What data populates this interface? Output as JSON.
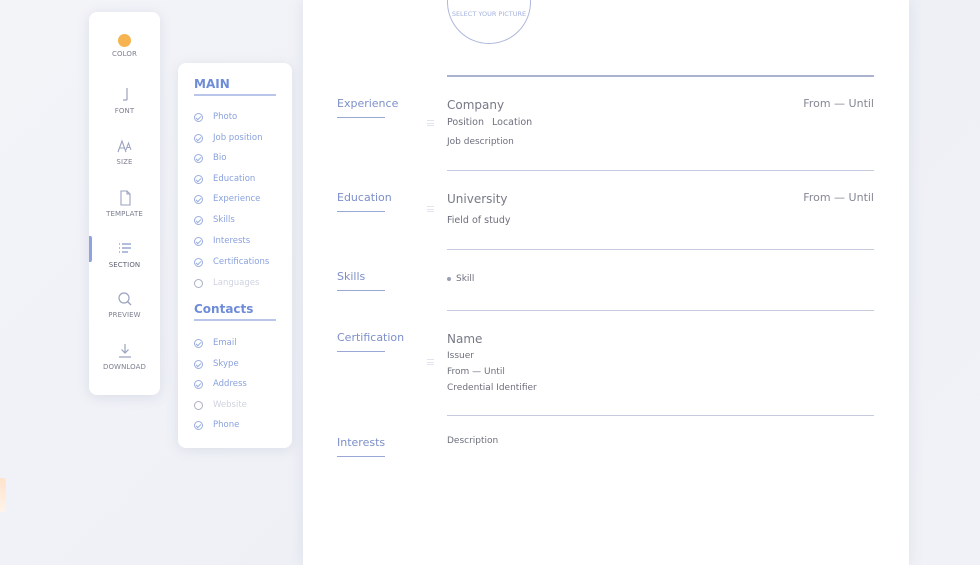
{
  "tools": [
    {
      "name": "color-tool",
      "icon": "color-dot-icon",
      "label": "COLOR"
    },
    {
      "name": "font-tool",
      "icon": "font-icon",
      "label": "FONT"
    },
    {
      "name": "size-tool",
      "icon": "text-size-icon",
      "label": "SIZE"
    },
    {
      "name": "template-tool",
      "icon": "document-icon",
      "label": "TEMPLATE"
    },
    {
      "name": "section-tool",
      "icon": "list-icon",
      "label": "SECTION"
    },
    {
      "name": "preview-tool",
      "icon": "search-icon",
      "label": "PREVIEW"
    },
    {
      "name": "download-tool",
      "icon": "download-icon",
      "label": "DOWNLOAD"
    }
  ],
  "accent_color": "#f5b44f",
  "sections_panel": {
    "main_title": "MAIN",
    "main_items": [
      {
        "label": "Photo",
        "enabled": true
      },
      {
        "label": "Job position",
        "enabled": true
      },
      {
        "label": "Bio",
        "enabled": true
      },
      {
        "label": "Education",
        "enabled": true
      },
      {
        "label": "Experience",
        "enabled": true
      },
      {
        "label": "Skills",
        "enabled": true
      },
      {
        "label": "Interests",
        "enabled": true
      },
      {
        "label": "Certifications",
        "enabled": true
      },
      {
        "label": "Languages",
        "enabled": false
      }
    ],
    "contacts_title": "Contacts",
    "contact_items": [
      {
        "label": "Email",
        "enabled": true
      },
      {
        "label": "Skype",
        "enabled": true
      },
      {
        "label": "Address",
        "enabled": true
      },
      {
        "label": "Website",
        "enabled": false
      },
      {
        "label": "Phone",
        "enabled": true
      }
    ]
  },
  "resume": {
    "photo_label": "SELECT YOUR PICTURE",
    "experience": {
      "title": "Experience",
      "company": "Company",
      "date": "From — Until",
      "position": "Position",
      "location": "Location",
      "description": "Job description"
    },
    "education": {
      "title": "Education",
      "university": "University",
      "date": "From — Until",
      "field": "Field of study"
    },
    "skills": {
      "title": "Skills",
      "item": "Skill"
    },
    "certification": {
      "title": "Certification",
      "name": "Name",
      "issuer": "Issuer",
      "date": "From — Until",
      "credential": "Credential Identifier"
    },
    "interests": {
      "title": "Interests",
      "description": "Description"
    }
  }
}
